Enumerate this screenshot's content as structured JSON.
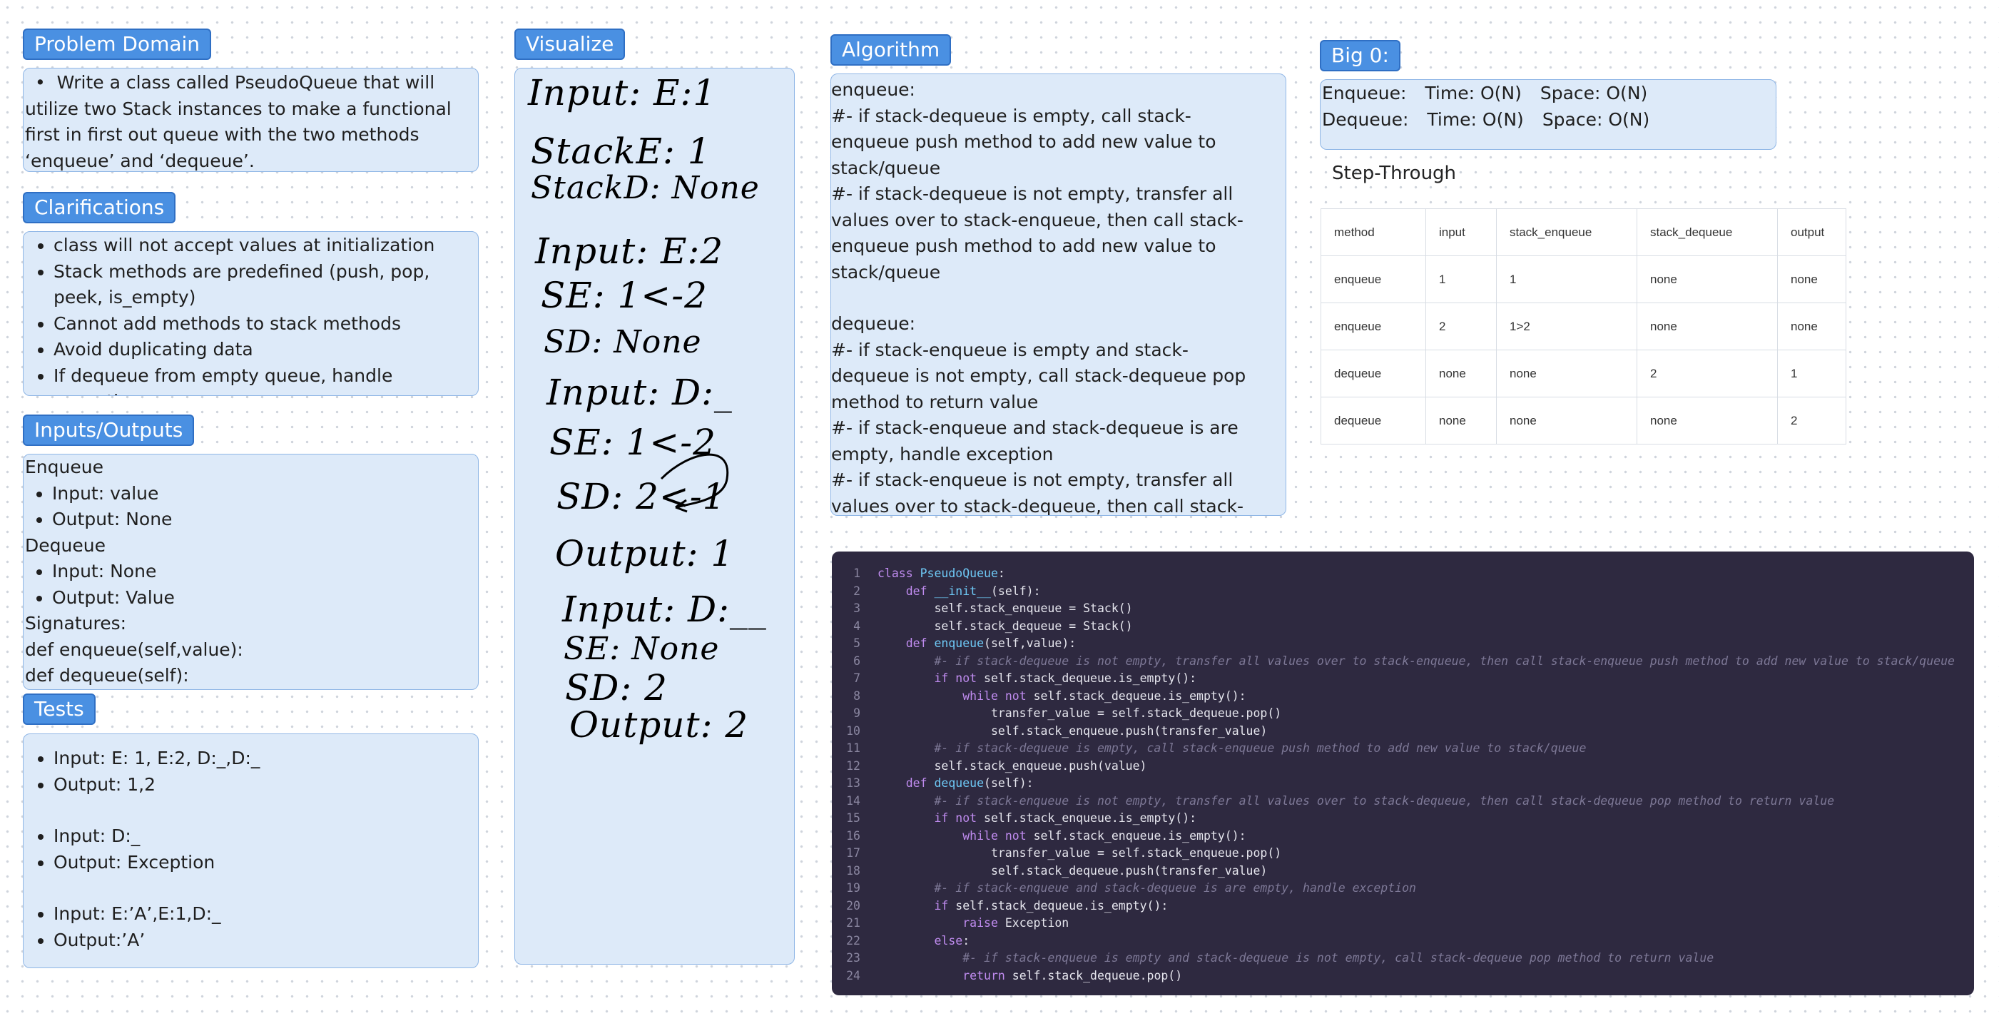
{
  "problem_domain": {
    "title": "Problem Domain",
    "items": [
      "Write a class called PseudoQueue that will utilize two Stack instances to make a functional first in first out queue with the two methods ‘enqueue’ and ‘dequeue’."
    ]
  },
  "clarifications": {
    "title": "Clarifications",
    "items": [
      "class will not accept values at initialization",
      "Stack methods are predefined (push, pop, peek, is_empty)",
      "Cannot add methods to stack methods",
      "Avoid duplicating data",
      "If dequeue from empty queue, handle exception"
    ]
  },
  "inputs_outputs": {
    "title": "Inputs/Outputs",
    "enqueue_label": "Enqueue",
    "enqueue_items": [
      "Input: value",
      "Output: None"
    ],
    "dequeue_label": "Dequeue",
    "dequeue_items": [
      "Input: None",
      "Output: Value"
    ],
    "signatures_label": "Signatures:",
    "sig1": "def enqueue(self,value):",
    "sig2": "def dequeue(self):"
  },
  "tests": {
    "title": "Tests",
    "items": [
      "Input: E: 1, E:2, D:_,D:_",
      "Output: 1,2",
      "Input: D:_",
      "Output: Exception",
      "Input: E:’A’,E:1,D:_",
      "Output:’A’"
    ]
  },
  "visualize": {
    "title": "Visualize",
    "lines": [
      "Input: E:1",
      "StackE: 1",
      "StackD: None",
      "Input: E:2",
      "SE: 1<-2",
      "SD: None",
      "Input: D:_",
      "SE: 1<-2",
      "SD: 2<-1",
      "Output: 1",
      "Input: D:__",
      "SE: None",
      "SD: 2",
      "Output: 2"
    ]
  },
  "algorithm": {
    "title": "Algorithm",
    "enqueue_head": "enqueue:",
    "enqueue_lines": [
      "#- if stack-dequeue is empty, call stack-enqueue push method to add new value to stack/queue",
      "#- if stack-dequeue is not empty, transfer all values over to stack-enqueue, then call stack-enqueue push method to add new value to stack/queue"
    ],
    "dequeue_head": "dequeue:",
    "dequeue_lines": [
      "#- if stack-enqueue is empty and stack-dequeue is not empty, call stack-dequeue pop method to return value",
      "#- if stack-enqueue and stack-dequeue is are empty, handle exception",
      "#- if stack-enqueue is not empty, transfer all values over to stack-dequeue, then call stack-dequeue pop method to return value"
    ]
  },
  "big_o": {
    "title": "Big 0:",
    "enqueue_label": "Enqueue:",
    "enqueue_time": "Time: O(N)",
    "enqueue_space": "Space: O(N)",
    "dequeue_label": "Dequeue:",
    "dequeue_time": "Time: O(N)",
    "dequeue_space": "Space: O(N)"
  },
  "step_through": {
    "title": "Step-Through",
    "headers": [
      "method",
      "input",
      "stack_enqueue",
      "stack_dequeue",
      "output"
    ],
    "rows": [
      [
        "enqueue",
        "1",
        "1",
        "none",
        "none"
      ],
      [
        "enqueue",
        "2",
        "1>2",
        "none",
        "none"
      ],
      [
        "dequeue",
        "none",
        "none",
        "2",
        "1"
      ],
      [
        "dequeue",
        "none",
        "none",
        "none",
        "2"
      ]
    ]
  },
  "code": {
    "lines": [
      "class PseudoQueue:",
      "    def __init__(self):",
      "        self.stack_enqueue = Stack()",
      "        self.stack_dequeue = Stack()",
      "    def enqueue(self,value):",
      "        #- if stack-dequeue is not empty, transfer all values over to stack-enqueue, then call stack-enqueue push method to add new value to stack/queue",
      "        if not self.stack_dequeue.is_empty():",
      "            while not self.stack_dequeue.is_empty():",
      "                transfer_value = self.stack_dequeue.pop()",
      "                self.stack_enqueue.push(transfer_value)",
      "        #- if stack-dequeue is empty, call stack-enqueue push method to add new value to stack/queue",
      "        self.stack_enqueue.push(value)",
      "    def dequeue(self):",
      "        #- if stack-enqueue is not empty, transfer all values over to stack-dequeue, then call stack-dequeue pop method to return value",
      "        if not self.stack_enqueue.is_empty():",
      "            while not self.stack_enqueue.is_empty():",
      "                transfer_value = self.stack_enqueue.pop()",
      "                self.stack_dequeue.push(transfer_value)",
      "        #- if stack-enqueue and stack-dequeue is are empty, handle exception",
      "        if self.stack_dequeue.is_empty():",
      "            raise Exception",
      "        else:",
      "            #- if stack-enqueue is empty and stack-dequeue is not empty, call stack-dequeue pop method to return value",
      "            return self.stack_dequeue.pop()"
    ]
  }
}
